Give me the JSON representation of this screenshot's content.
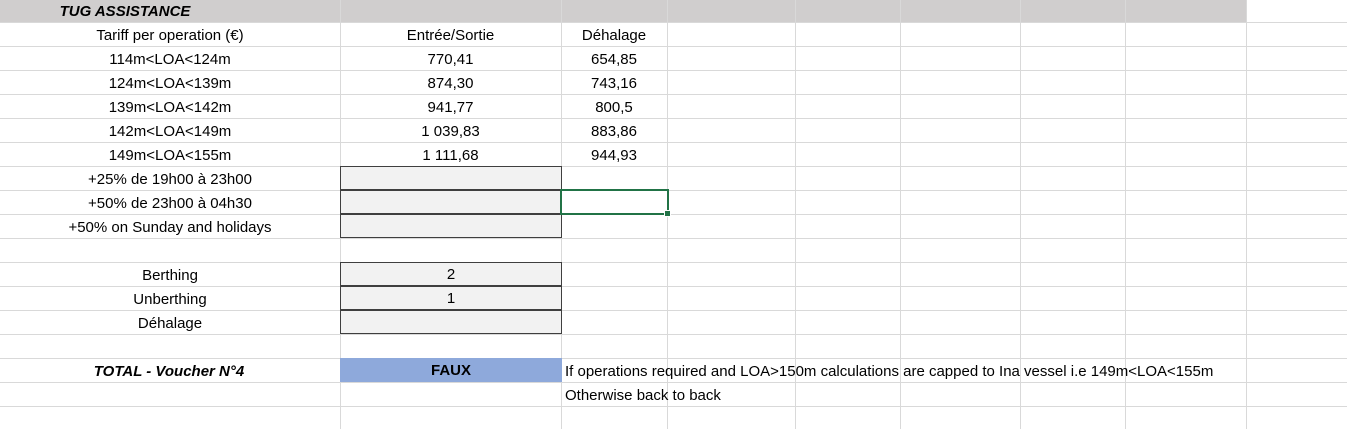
{
  "title": "TUG ASSISTANCE",
  "headers": {
    "tariff": "Tariff per operation (€)",
    "entree_sortie": "Entrée/Sortie",
    "dehalage": "Déhalage"
  },
  "rates": [
    {
      "range": "114m<LOA<124m",
      "entree_sortie": "770,41",
      "dehalage": "654,85"
    },
    {
      "range": "124m<LOA<139m",
      "entree_sortie": "874,30",
      "dehalage": "743,16"
    },
    {
      "range": "139m<LOA<142m",
      "entree_sortie": "941,77",
      "dehalage": "800,5"
    },
    {
      "range": "142m<LOA<149m",
      "entree_sortie": "1 039,83",
      "dehalage": "883,86"
    },
    {
      "range": "149m<LOA<155m",
      "entree_sortie": "1 111,68",
      "dehalage": "944,93"
    }
  ],
  "surcharges": [
    {
      "label": "+25% de 19h00 à 23h00",
      "value": ""
    },
    {
      "label": "+50% de 23h00 à 04h30",
      "value": ""
    },
    {
      "label": "+50% on Sunday and holidays",
      "value": ""
    }
  ],
  "operations": [
    {
      "label": "Berthing",
      "value": "2"
    },
    {
      "label": "Unberthing",
      "value": "1"
    },
    {
      "label": "Déhalage",
      "value": ""
    }
  ],
  "total": {
    "label": "TOTAL - Voucher N°4",
    "value": "FAUX",
    "note_1": "If operations required and LOA>150m calculations are capped to Ina vessel i.e 149m<LOA<155m",
    "note_2": "Otherwise back to back"
  },
  "colors": {
    "header_band": "#d0cece",
    "input_fill": "#f2f2f2",
    "total_fill": "#8ea9db",
    "selection": "#217346",
    "gridline": "#d9d9d9"
  }
}
